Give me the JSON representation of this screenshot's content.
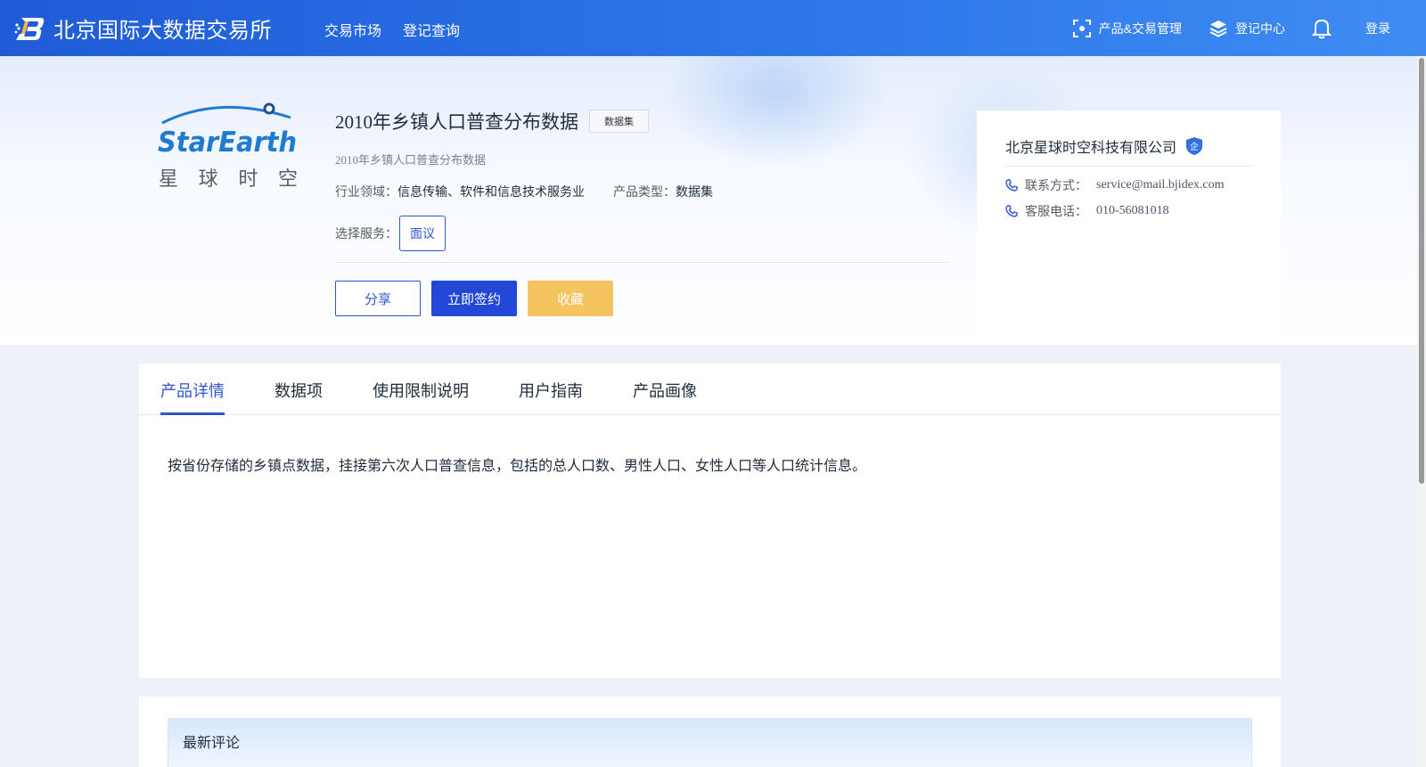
{
  "header": {
    "brand": "北京国际大数据交易所",
    "nav": [
      "交易市场",
      "登记查询"
    ],
    "product_trade_mgmt": "产品&交易管理",
    "registration_center": "登记中心",
    "login": "登录"
  },
  "product": {
    "logo_text": "StarEarth",
    "logo_cn": "星 球 时 空",
    "title": "2010年乡镇人口普查分布数据",
    "tag": "数据集",
    "subtitle": "2010年乡镇人口普查分布数据",
    "industry_label": "行业领域：",
    "industry_value": "信息传输、软件和信息技术服务业",
    "type_label": "产品类型：",
    "type_value": "数据集",
    "service_label": "选择服务：",
    "service_option": "面议",
    "share": "分享",
    "sign": "立即签约",
    "favorite": "收藏"
  },
  "company": {
    "name": "北京星球时空科技有限公司",
    "badge": "企",
    "contact_label": "联系方式：",
    "contact_value": "service@mail.bjidex.com",
    "phone_label": "客服电话：",
    "phone_value": "010-56081018"
  },
  "tabs": [
    "产品详情",
    "数据项",
    "使用限制说明",
    "用户指南",
    "产品画像"
  ],
  "detail": {
    "description": "按省份存储的乡镇点数据，挂接第六次人口普查信息，包括的总人口数、男性人口、女性人口等人口统计信息。"
  },
  "comments": {
    "title": "最新评论"
  },
  "colors": {
    "primary": "#2348d8",
    "accent_yellow": "#f5c45e",
    "header_start": "#1f5bd6",
    "header_end": "#3f8cf2"
  }
}
